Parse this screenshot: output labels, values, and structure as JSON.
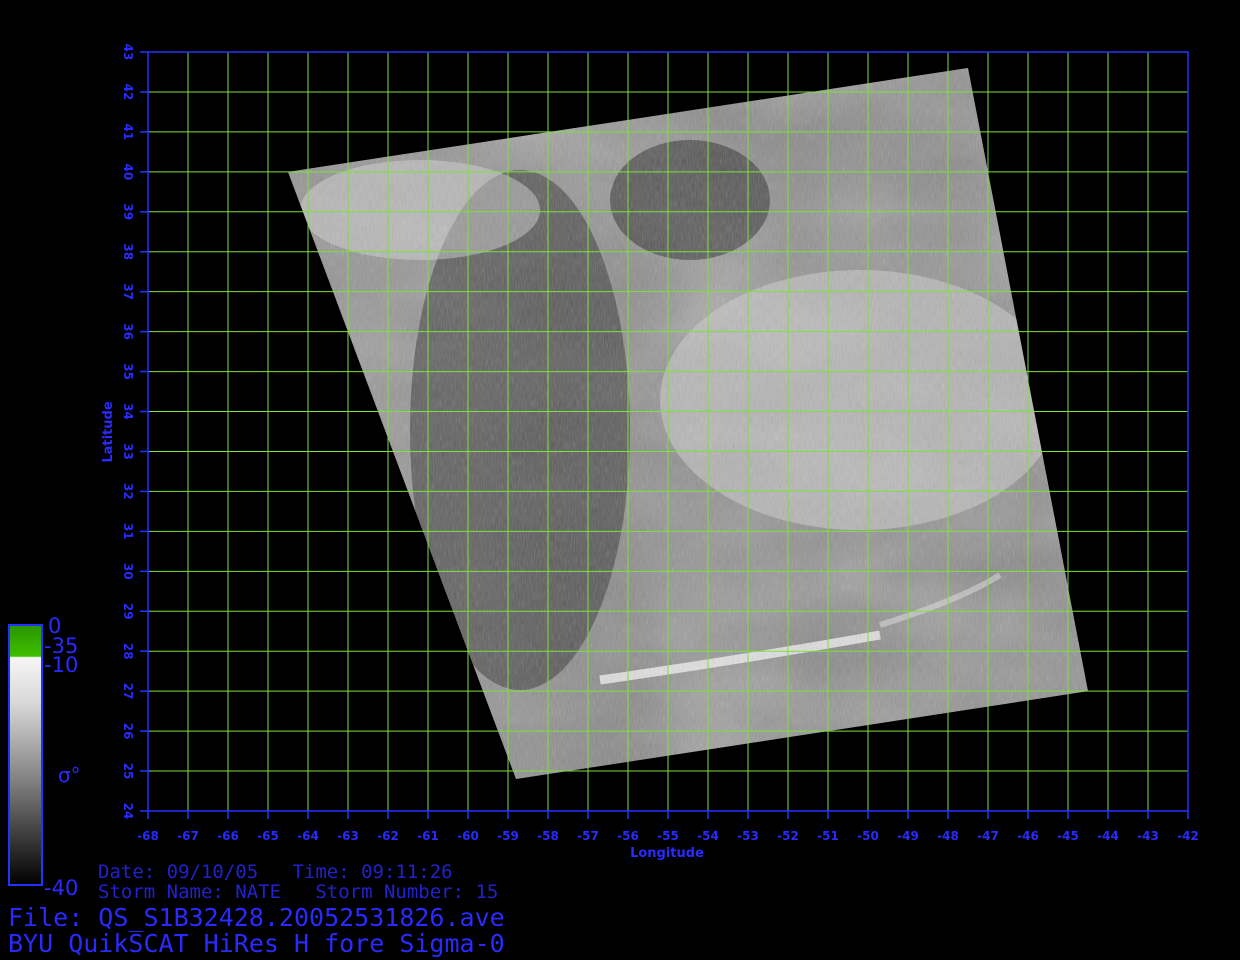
{
  "image": {
    "colors": {
      "background": "#000000",
      "grid": "#7fe03a",
      "frame": "#2233ff",
      "label": "#2a2aff",
      "info_text": "#2222cc",
      "colorbar_top": "#33bb00"
    },
    "axes": {
      "xlabel": "Longitude",
      "ylabel": "Latitude",
      "xlim": [
        -68,
        -42
      ],
      "ylim": [
        24,
        43
      ],
      "xticks": [
        "-68",
        "-67",
        "-66",
        "-65",
        "-64",
        "-63",
        "-62",
        "-61",
        "-60",
        "-59",
        "-58",
        "-57",
        "-56",
        "-55",
        "-54",
        "-53",
        "-52",
        "-51",
        "-50",
        "-49",
        "-48",
        "-47",
        "-46",
        "-45",
        "-44",
        "-43",
        "-42"
      ],
      "yticks": [
        "24",
        "25",
        "26",
        "27",
        "28",
        "29",
        "30",
        "31",
        "32",
        "33",
        "34",
        "35",
        "36",
        "37",
        "38",
        "39",
        "40",
        "41",
        "42",
        "43"
      ]
    },
    "swath": {
      "corners_lonlat": [
        [
          -64.5,
          40.0
        ],
        [
          -47.5,
          42.6
        ],
        [
          -44.5,
          27.0
        ],
        [
          -58.8,
          24.8
        ]
      ]
    },
    "colorbar": {
      "label": "σ°",
      "ticks": [
        "0",
        "-35",
        "-10",
        "-40"
      ]
    },
    "info": {
      "line1": "Date: 09/10/05   Time: 09:11:26",
      "line2": "Storm Name: NATE   Storm Number: 15",
      "file": "File: QS_S1B32428.20052531826.ave",
      "product": "BYU QuikSCAT HiRes H fore Sigma-0"
    }
  }
}
